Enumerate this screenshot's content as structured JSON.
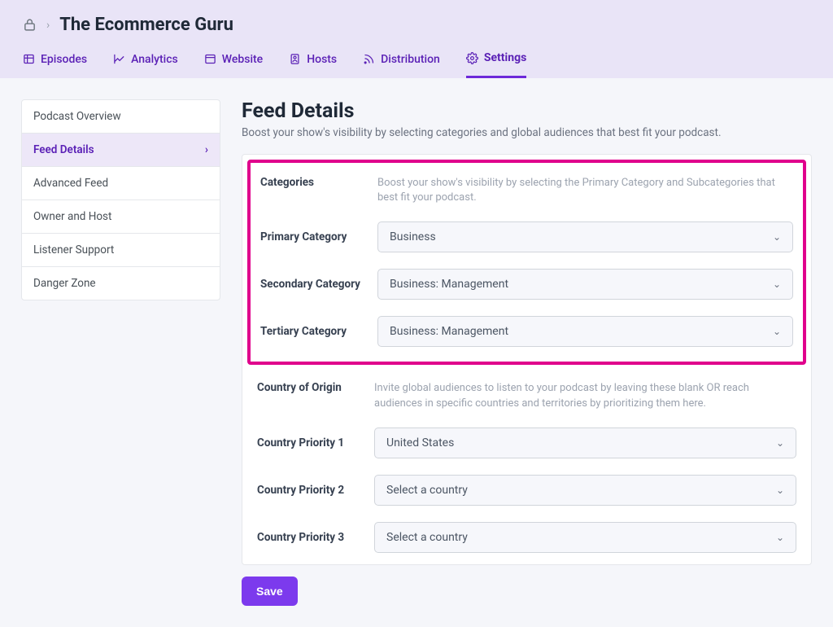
{
  "breadcrumb": {
    "title": "The Ecommerce Guru"
  },
  "tabs": [
    {
      "label": "Episodes"
    },
    {
      "label": "Analytics"
    },
    {
      "label": "Website"
    },
    {
      "label": "Hosts"
    },
    {
      "label": "Distribution"
    },
    {
      "label": "Settings",
      "active": true
    }
  ],
  "sidebar": {
    "items": [
      {
        "label": "Podcast Overview"
      },
      {
        "label": "Feed Details",
        "active": true
      },
      {
        "label": "Advanced Feed"
      },
      {
        "label": "Owner and Host"
      },
      {
        "label": "Listener Support"
      },
      {
        "label": "Danger Zone"
      }
    ]
  },
  "page": {
    "title": "Feed Details",
    "subtitle": "Boost your show's visibility by selecting categories and global audiences that best fit your podcast."
  },
  "form": {
    "categories_label": "Categories",
    "categories_desc": "Boost your show's visibility by selecting the Primary Category and Subcategories that best fit your podcast.",
    "primary_category_label": "Primary Category",
    "primary_category_value": "Business",
    "secondary_category_label": "Secondary Category",
    "secondary_category_value": "Business: Management",
    "tertiary_category_label": "Tertiary Category",
    "tertiary_category_value": "Business: Management",
    "country_origin_label": "Country of Origin",
    "country_origin_desc": "Invite global audiences to listen to your podcast by leaving these blank OR reach audiences in specific countries and territories by prioritizing them here.",
    "country1_label": "Country Priority 1",
    "country1_value": "United States",
    "country2_label": "Country Priority 2",
    "country2_value": "Select a country",
    "country3_label": "Country Priority 3",
    "country3_value": "Select a country"
  },
  "actions": {
    "save_label": "Save"
  }
}
